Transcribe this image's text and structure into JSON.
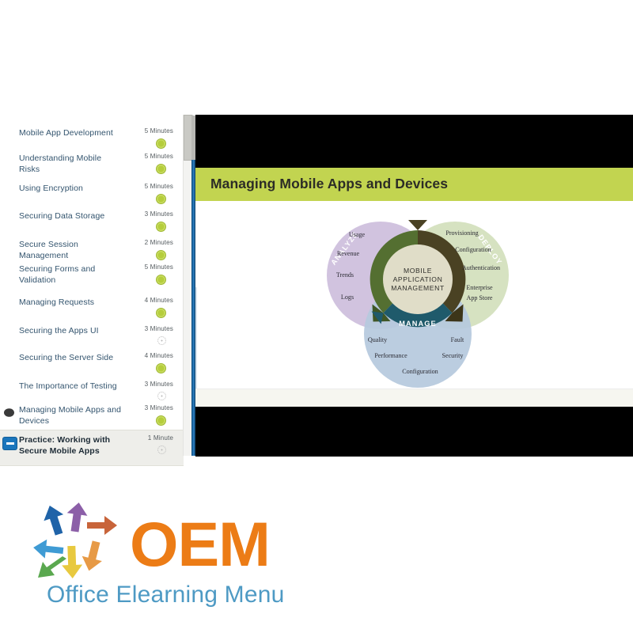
{
  "outline": {
    "lessons": [
      {
        "title": "Mobile App Development",
        "duration": "5 Minutes",
        "status": "done",
        "icon": "none"
      },
      {
        "title": "Understanding Mobile Risks",
        "duration": "5 Minutes",
        "status": "done",
        "icon": "none"
      },
      {
        "title": "Using Encryption",
        "duration": "5 Minutes",
        "status": "done",
        "icon": "none"
      },
      {
        "title": "Securing Data Storage",
        "duration": "3 Minutes",
        "status": "done",
        "icon": "none"
      },
      {
        "title": "Secure Session Management",
        "duration": "2 Minutes",
        "status": "done",
        "icon": "none"
      },
      {
        "title": "Securing Forms and Validation",
        "duration": "5 Minutes",
        "status": "done",
        "icon": "none"
      },
      {
        "title": "Managing Requests",
        "duration": "4 Minutes",
        "status": "done",
        "icon": "none"
      },
      {
        "title": "Securing the Apps UI",
        "duration": "3 Minutes",
        "status": "todo",
        "icon": "none"
      },
      {
        "title": "Securing the Server Side",
        "duration": "4 Minutes",
        "status": "done",
        "icon": "none"
      },
      {
        "title": "The Importance of Testing",
        "duration": "3 Minutes",
        "status": "todo",
        "icon": "none"
      },
      {
        "title": "Managing Mobile Apps and Devices",
        "duration": "3 Minutes",
        "status": "done",
        "icon": "pointer-icon"
      },
      {
        "title": "Practice: Working with Secure Mobile Apps",
        "duration": "1 Minute",
        "status": "todo",
        "icon": "minus-box-icon",
        "current": true
      }
    ]
  },
  "player": {
    "slide_title": "Managing Mobile Apps and Devices",
    "title_bar_color": "#c2d450",
    "letterbox_color": "#000000"
  },
  "diagram": {
    "core": [
      "MOBILE",
      "APPLICATION",
      "MANAGEMENT"
    ],
    "circles": [
      {
        "name": "ANALYZE",
        "color": "#cdbedd",
        "arc_color": "#4f6b30",
        "items": [
          "Usage",
          "Revenue",
          "Trends",
          "Logs"
        ]
      },
      {
        "name": "DEPLOY",
        "color": "#d3e0bc",
        "arc_color": "#4a4223",
        "items": [
          "Provisioning",
          "Configuration",
          "Authentication",
          "Enterprise",
          "App Store"
        ]
      },
      {
        "name": "MANAGE",
        "color": "#b6c9de",
        "arc_color": "#1f5a6b",
        "items": [
          "Quality",
          "Fault",
          "Performance",
          "Security",
          "Configuration"
        ]
      }
    ]
  },
  "logo": {
    "wordmark": "OEM",
    "tagline": "Office Elearning Menu",
    "wordmark_color": "#ec7c16",
    "tagline_color": "#4e9ac4",
    "arrow_colors": [
      "#1f63a8",
      "#8c5fa8",
      "#c8643a",
      "#3f9bd4",
      "#e8c93f",
      "#5aa84f",
      "#e79a46"
    ]
  }
}
